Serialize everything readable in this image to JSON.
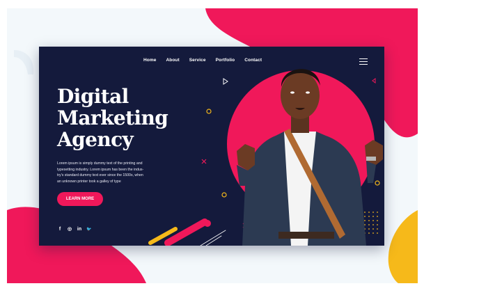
{
  "nav": {
    "items": [
      {
        "label": "Home"
      },
      {
        "label": "About"
      },
      {
        "label": "Service"
      },
      {
        "label": "Portfolio"
      },
      {
        "label": "Contact"
      }
    ]
  },
  "hero": {
    "title_lines": [
      "Digital",
      "Marketing",
      "Agency"
    ],
    "body_lines": [
      "Lorem ipsum is simply dummy text of the printing and",
      "typesetting industry. Lorem ipsum has been the indus-",
      "try's standard dummy text ever since the 1500s, when",
      "an unknown printer took a galley of type"
    ],
    "cta_label": "LEARN MORE"
  },
  "social": {
    "facebook": "f",
    "instagram": "◎",
    "linkedin": "in",
    "twitter": "🐦"
  },
  "colors": {
    "navy": "#141a3c",
    "pink": "#f0185a",
    "yellow": "#f6b91a",
    "white": "#ffffff"
  },
  "icons": [
    "menu-icon",
    "facebook-icon",
    "instagram-icon",
    "linkedin-icon",
    "twitter-icon",
    "person-photo"
  ]
}
